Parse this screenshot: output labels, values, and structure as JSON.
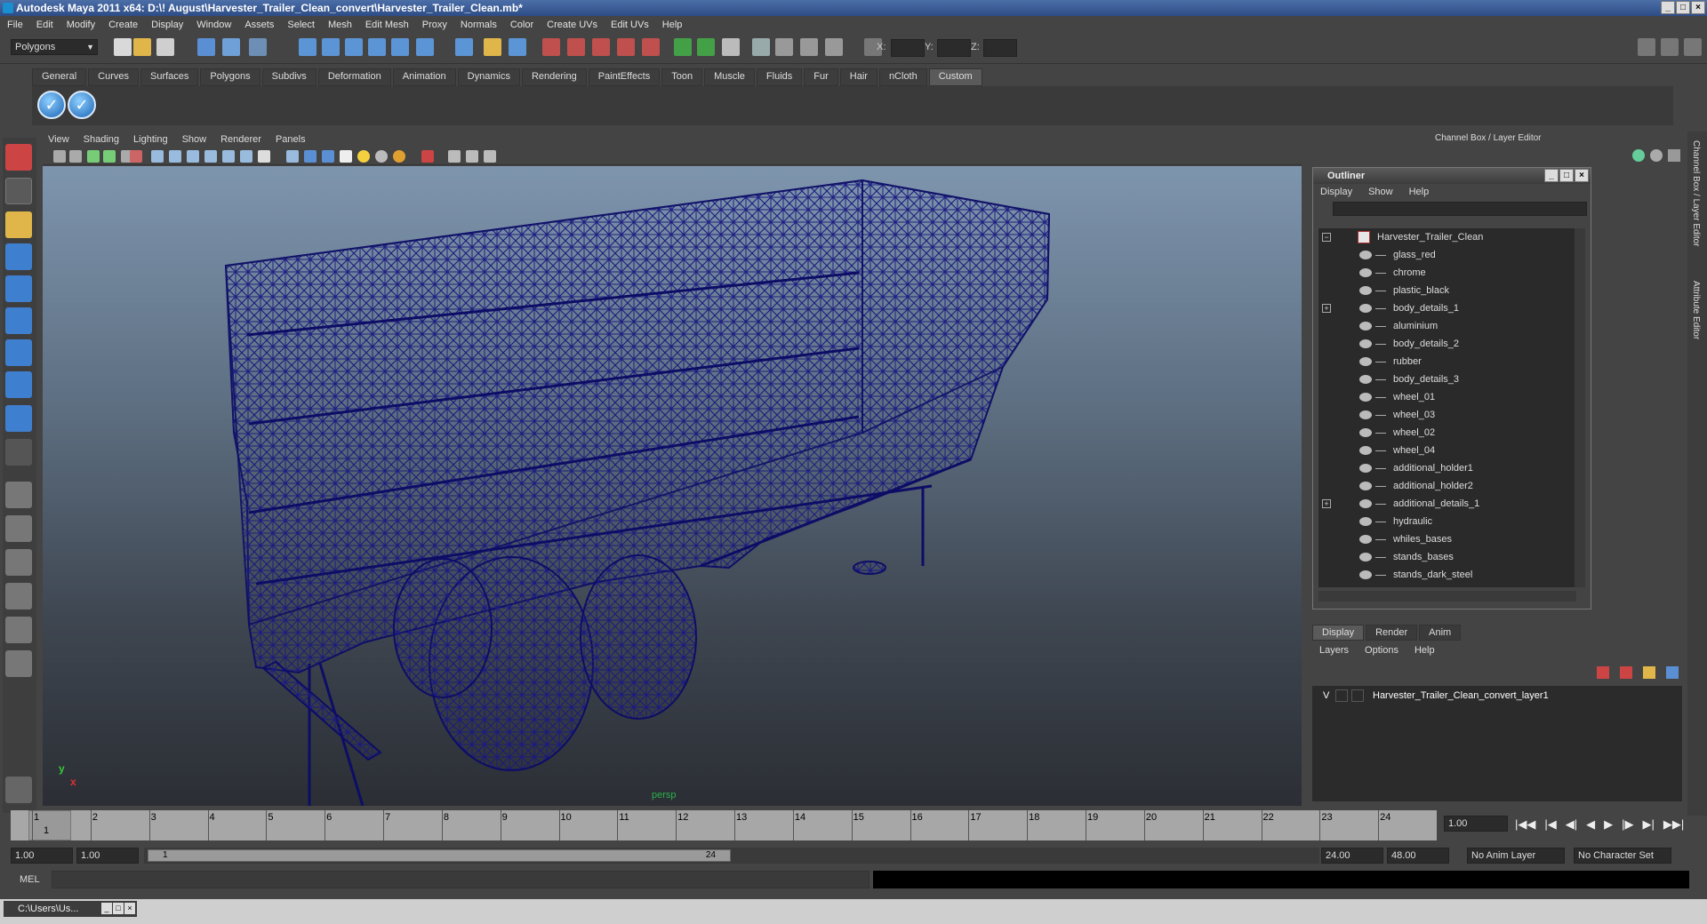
{
  "window": {
    "title": "Autodesk Maya 2011 x64: D:\\! August\\Harvester_Trailer_Clean_convert\\Harvester_Trailer_Clean.mb*",
    "min": "_",
    "max": "□",
    "close": "×"
  },
  "menu": [
    "File",
    "Edit",
    "Modify",
    "Create",
    "Display",
    "Window",
    "Assets",
    "Select",
    "Mesh",
    "Edit Mesh",
    "Proxy",
    "Normals",
    "Color",
    "Create UVs",
    "Edit UVs",
    "Help"
  ],
  "status_line": {
    "mode": "Polygons",
    "x_label": "X:",
    "y_label": "Y:",
    "z_label": "Z:"
  },
  "shelf": {
    "tabs": [
      "General",
      "Curves",
      "Surfaces",
      "Polygons",
      "Subdivs",
      "Deformation",
      "Animation",
      "Dynamics",
      "Rendering",
      "PaintEffects",
      "Toon",
      "Muscle",
      "Fluids",
      "Fur",
      "Hair",
      "nCloth",
      "Custom"
    ],
    "active": "Custom"
  },
  "viewport": {
    "menu": [
      "View",
      "Shading",
      "Lighting",
      "Show",
      "Renderer",
      "Panels"
    ],
    "camera": "persp",
    "axis_y": "y",
    "axis_x": "x",
    "wire_color": "#0d0d66"
  },
  "channel_box": {
    "title": "Channel Box / Layer Editor"
  },
  "outliner": {
    "title": "Outliner",
    "menu": [
      "Display",
      "Show",
      "Help"
    ],
    "root": "Harvester_Trailer_Clean",
    "items": [
      {
        "label": "glass_red",
        "expandable": false
      },
      {
        "label": "chrome",
        "expandable": false
      },
      {
        "label": "plastic_black",
        "expandable": false
      },
      {
        "label": "body_details_1",
        "expandable": true
      },
      {
        "label": "aluminium",
        "expandable": false
      },
      {
        "label": "body_details_2",
        "expandable": false
      },
      {
        "label": "rubber",
        "expandable": false
      },
      {
        "label": "body_details_3",
        "expandable": false
      },
      {
        "label": "wheel_01",
        "expandable": false
      },
      {
        "label": "wheel_03",
        "expandable": false
      },
      {
        "label": "wheel_02",
        "expandable": false
      },
      {
        "label": "wheel_04",
        "expandable": false
      },
      {
        "label": "additional_holder1",
        "expandable": false
      },
      {
        "label": "additional_holder2",
        "expandable": false
      },
      {
        "label": "additional_details_1",
        "expandable": true
      },
      {
        "label": "hydraulic",
        "expandable": false
      },
      {
        "label": "whiles_bases",
        "expandable": false
      },
      {
        "label": "stands_bases",
        "expandable": false
      },
      {
        "label": "stands_dark_steel",
        "expandable": false
      }
    ]
  },
  "layer_editor": {
    "tabs": [
      "Display",
      "Render",
      "Anim"
    ],
    "active": "Display",
    "menu": [
      "Layers",
      "Options",
      "Help"
    ],
    "layer": {
      "visible": "V",
      "name": "Harvester_Trailer_Clean_convert_layer1"
    }
  },
  "right_strip": {
    "channel_tab": "Channel Box / Layer Editor",
    "attr_tab": "Attribute Editor"
  },
  "timeline": {
    "ticks": [
      "1",
      "2",
      "3",
      "4",
      "5",
      "6",
      "7",
      "8",
      "9",
      "10",
      "11",
      "12",
      "13",
      "14",
      "15",
      "16",
      "17",
      "18",
      "19",
      "20",
      "21",
      "22",
      "23",
      "24"
    ],
    "current_frame": "1.00",
    "current_marker": "1"
  },
  "range": {
    "start": "1.00",
    "start2": "1.00",
    "slider_start": "1",
    "slider_end": "24",
    "end": "24.00",
    "end2": "48.00",
    "anim_layer": "No Anim Layer",
    "char_set": "No Character Set"
  },
  "command": {
    "label": "MEL"
  },
  "taskbar": {
    "item": "C:\\Users\\Us..."
  },
  "playback_glyphs": [
    "|◀◀",
    "|◀",
    "◀|",
    "◀",
    "▶",
    "|▶",
    "▶|",
    "▶▶|"
  ]
}
